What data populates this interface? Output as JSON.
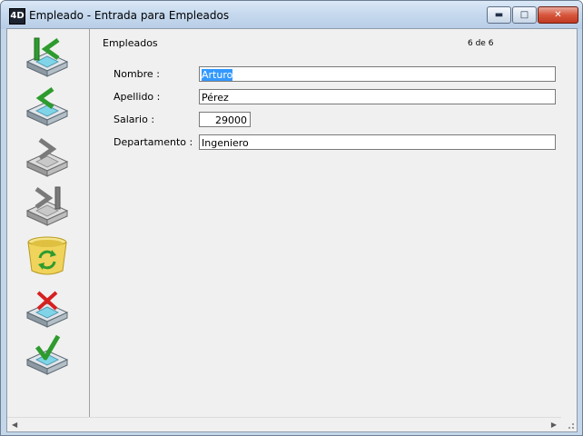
{
  "window": {
    "title": "Empleado - Entrada para Empleados",
    "app_icon_text": "4D"
  },
  "toolbar": {
    "buttons": [
      {
        "name": "first-record",
        "icon": "first-record-icon"
      },
      {
        "name": "previous-record",
        "icon": "previous-record-icon"
      },
      {
        "name": "next-record",
        "icon": "next-record-icon"
      },
      {
        "name": "last-record",
        "icon": "last-record-icon"
      },
      {
        "name": "delete-record",
        "icon": "trash-bin-icon"
      },
      {
        "name": "cancel",
        "icon": "cancel-icon"
      },
      {
        "name": "accept",
        "icon": "accept-icon"
      }
    ]
  },
  "form": {
    "title": "Empleados",
    "record_count": "6 de 6",
    "fields": {
      "nombre": {
        "label": "Nombre :",
        "value": "Arturo"
      },
      "apellido": {
        "label": "Apellido :",
        "value": "Pérez"
      },
      "salario": {
        "label": "Salario :",
        "value": "29000"
      },
      "departamento": {
        "label": "Departamento :",
        "value": "Ingeniero"
      }
    }
  },
  "colors": {
    "selection": "#3399ff",
    "accent_green": "#2e9b2e",
    "cancel_red": "#d62020",
    "drive_body": "#9aa6ae"
  }
}
